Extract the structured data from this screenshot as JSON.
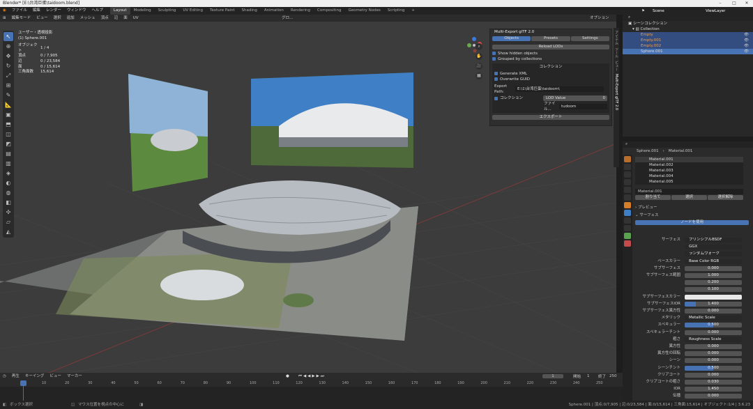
{
  "window": {
    "title": "Blender* [E:\\台湾巨蛋\\taidoom.blend]"
  },
  "menu": [
    "ファイル",
    "編集",
    "レンダー",
    "ウィンドウ",
    "ヘルプ"
  ],
  "workspaces": [
    "Layout",
    "Modeling",
    "Sculpting",
    "UV Editing",
    "Texture Paint",
    "Shading",
    "Animation",
    "Rendering",
    "Compositing",
    "Geometry Nodes",
    "Scripting"
  ],
  "scene": {
    "name": "Scene",
    "view_layer": "ViewLayer"
  },
  "viewport_header": {
    "mode": "編集モード",
    "menus": [
      "ビュー",
      "選択",
      "追加",
      "メッシュ",
      "頂点",
      "辺",
      "面",
      "UV"
    ],
    "transform": "グロ...",
    "options": "オプション"
  },
  "hud": {
    "view": "ユーザー・透視投影",
    "object": "(1) Sphere.001",
    "objects_label": "オブジェクト",
    "objects_value": "1 / 4",
    "vertices_label": "頂点",
    "vertices_value": "0 / 7,905",
    "edges_label": "辺",
    "edges_value": "0 / 23,584",
    "faces_label": "面",
    "faces_value": "0 / 15,614",
    "tris_label": "三角面数",
    "tris_value": "15,614"
  },
  "tools": [
    "select",
    "cursor",
    "move",
    "rotate",
    "scale",
    "transform",
    "annotate",
    "measure",
    "add-cube",
    "extrude",
    "inset",
    "bevel",
    "loopcut",
    "knife",
    "polybuild",
    "spin",
    "smooth",
    "edge-slide",
    "shrink",
    "shear",
    "rip"
  ],
  "npanel": {
    "title": "Multi-Export glTF 2.0",
    "tabs": [
      "Objects",
      "Presets",
      "Settings"
    ],
    "reload": "Reload LODs",
    "show_hidden": "Show hidden objects",
    "grouped": "Grouped by collections",
    "collection_header": "コレクション",
    "generate_xml": "Generate XML",
    "overwrite_guid": "Overwrite GUID",
    "export_path_label": "Export Path:",
    "export_path": "E:\\1\\台湾巨蛋\\taidoom\\",
    "collection_label": "コレクション",
    "lod_value": "LOD Value",
    "lod_num": "0",
    "file_label": "ファイル...",
    "file_value": "tudoom",
    "export_btn": "エクスポート"
  },
  "side_tabs": [
    "アイテム",
    "ツール",
    "ビュー",
    "Multi-Export glTF 2.0"
  ],
  "outliner": {
    "root": "シーンコレクション",
    "collection": "Collection",
    "items": [
      "Empty",
      "Empty.001",
      "Empty.002",
      "Sphere.001"
    ]
  },
  "props": {
    "object": "Sphere.001",
    "material_header": "Material.001",
    "materials": [
      "Material.001",
      "Material.002",
      "Material.003",
      "Material.004",
      "Material.005"
    ],
    "mat_name": "Material.001",
    "assign": "割り当て",
    "select": "選択",
    "deselect": "選択解除",
    "preview": "プレビュー",
    "surface": "サーフェス",
    "use_nodes": "ノードを使用",
    "rows": [
      {
        "label": "サーフェス",
        "value": "プリンシプルBSDF",
        "kind": "dark"
      },
      {
        "label": "",
        "value": "GGX",
        "kind": "dark"
      },
      {
        "label": "",
        "value": "ランダムウォーク",
        "kind": "dark"
      },
      {
        "label": "ベースカラー",
        "value": "Base Color RGB",
        "kind": "dark"
      },
      {
        "label": "サブサーフェス",
        "value": "0.000",
        "kind": "num"
      },
      {
        "label": "サブサーフェス範囲",
        "value": "1.000",
        "kind": "num"
      },
      {
        "label": "",
        "value": "0.200",
        "kind": "num"
      },
      {
        "label": "",
        "value": "0.100",
        "kind": "num"
      },
      {
        "label": "サブサーフェスカラー",
        "value": "",
        "kind": "white"
      },
      {
        "label": "サブサーフェスIOR",
        "value": "1.400",
        "kind": "num",
        "fill": 0.2
      },
      {
        "label": "サブサーフェス異方性",
        "value": "0.000",
        "kind": "num"
      },
      {
        "label": "メタリック",
        "value": "Metallic Scale",
        "kind": "dark"
      },
      {
        "label": "スペキュラー",
        "value": "0.500",
        "kind": "num",
        "fill": 0.5
      },
      {
        "label": "スペキュラーチント",
        "value": "0.000",
        "kind": "num"
      },
      {
        "label": "粗さ",
        "value": "Roughness Scale",
        "kind": "dark"
      },
      {
        "label": "異方性",
        "value": "0.000",
        "kind": "num"
      },
      {
        "label": "異方性の回転",
        "value": "0.000",
        "kind": "num"
      },
      {
        "label": "シーン",
        "value": "0.000",
        "kind": "num"
      },
      {
        "label": "シーンチント",
        "value": "0.500",
        "kind": "num",
        "fill": 0.5
      },
      {
        "label": "クリアコート",
        "value": "0.000",
        "kind": "num"
      },
      {
        "label": "クリアコートの粗さ",
        "value": "0.030",
        "kind": "num"
      },
      {
        "label": "IOR",
        "value": "1.450",
        "kind": "num"
      },
      {
        "label": "伝播",
        "value": "0.000",
        "kind": "num"
      },
      {
        "label": "伝播の粗さ",
        "value": "0.000",
        "kind": "num"
      }
    ]
  },
  "timeline": {
    "menus": [
      "再生",
      "キーイング",
      "ビュー",
      "マーカー"
    ],
    "current": "1",
    "start_label": "開始",
    "start": "1",
    "end_label": "終了",
    "end": "250",
    "ticks": [
      "1",
      "10",
      "20",
      "30",
      "40",
      "50",
      "60",
      "70",
      "80",
      "90",
      "100",
      "110",
      "120",
      "130",
      "140",
      "150",
      "160",
      "170",
      "180",
      "190",
      "200",
      "210",
      "220",
      "230",
      "240",
      "250"
    ]
  },
  "status": {
    "left": "ボックス選択",
    "mid": "マウス位置を視点の中心に",
    "right": "Sphere.001 | 頂点:0/7,905 | 辺:0/23,584 | 面:0/15,614 | 三角面:15,614 | オブジェクト:1/4 | 3.6.23"
  }
}
